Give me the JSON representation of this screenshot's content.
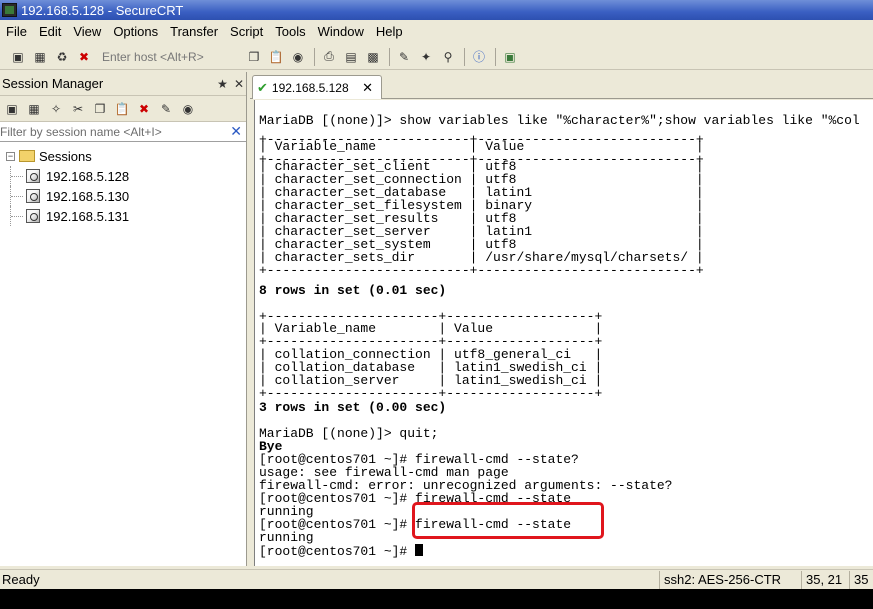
{
  "window": {
    "title": "192.168.5.128 - SecureCRT"
  },
  "menu": [
    "File",
    "Edit",
    "View",
    "Options",
    "Transfer",
    "Script",
    "Tools",
    "Window",
    "Help"
  ],
  "toolbar": {
    "host_placeholder": "Enter host <Alt+R>"
  },
  "session_manager": {
    "title": "Session Manager",
    "filter_placeholder": "Filter by session name <Alt+I>",
    "root_folder": "Sessions",
    "sessions": [
      "192.168.5.128",
      "192.168.5.130",
      "192.168.5.131"
    ]
  },
  "tab": {
    "label": "192.168.5.128"
  },
  "terminal": {
    "lines": [
      "MariaDB [(none)]> show variables like \"%character%\";show variables like \"%col",
      "+--------------------------+----------------------------+",
      "| Variable_name            | Value                      |",
      "+--------------------------+----------------------------+",
      "| character_set_client     | utf8                       |",
      "| character_set_connection | utf8                       |",
      "| character_set_database   | latin1                     |",
      "| character_set_filesystem | binary                     |",
      "| character_set_results    | utf8                       |",
      "| character_set_server     | latin1                     |",
      "| character_set_system     | utf8                       |",
      "| character_sets_dir       | /usr/share/mysql/charsets/ |",
      "+--------------------------+----------------------------+",
      "8 rows in set (0.01 sec)",
      "",
      "+----------------------+-------------------+",
      "| Variable_name        | Value             |",
      "+----------------------+-------------------+",
      "| collation_connection | utf8_general_ci   |",
      "| collation_database   | latin1_swedish_ci |",
      "| collation_server     | latin1_swedish_ci |",
      "+----------------------+-------------------+",
      "3 rows in set (0.00 sec)",
      "",
      "MariaDB [(none)]> quit;",
      "Bye",
      "[root@centos701 ~]# firewall-cmd --state?",
      "usage: see firewall-cmd man page",
      "firewall-cmd: error: unrecognized arguments: --state?",
      "[root@centos701 ~]# firewall-cmd --state",
      "running",
      "[root@centos701 ~]# firewall-cmd --state",
      "running",
      "[root@centos701 ~]# "
    ],
    "bold_lines": [
      13,
      22,
      25
    ]
  },
  "status": {
    "ready": "Ready",
    "connection": "ssh2: AES-256-CTR",
    "position": "35,  21",
    "rows": "35"
  }
}
